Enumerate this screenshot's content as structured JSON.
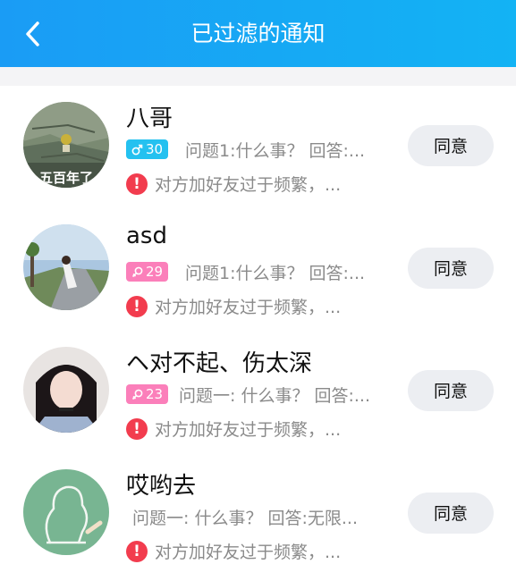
{
  "header": {
    "title": "已过滤的通知",
    "back_icon": "chevron-left-icon"
  },
  "colors": {
    "header_start": "#1a9cf5",
    "header_end": "#13b3f4",
    "male_badge": "#24c1f0",
    "female_badge": "#fb7fba",
    "warning": "#f23c4e"
  },
  "notifications": [
    {
      "name": "八哥",
      "gender": "male",
      "gender_icon": "male-icon",
      "age": "30",
      "question": "问题1:什么事？ 回答:...",
      "warning": "对方加好友过于频繁，...",
      "action": "同意",
      "avatar_caption": "五百年了"
    },
    {
      "name": "asd",
      "gender": "female",
      "gender_icon": "female-icon",
      "age": "29",
      "question": "问题1:什么事？ 回答:...",
      "warning": "对方加好友过于频繁，...",
      "action": "同意"
    },
    {
      "name": "ヘ对不起、伤太深",
      "gender": "female",
      "gender_icon": "female-icon",
      "age": "23",
      "question": "问题一: 什么事？ 回答:...",
      "warning": "对方加好友过于频繁，...",
      "action": "同意"
    },
    {
      "name": "哎哟去",
      "question": "问题一: 什么事？ 回答:无限...",
      "warning": "对方加好友过于频繁，...",
      "action": "同意"
    }
  ]
}
